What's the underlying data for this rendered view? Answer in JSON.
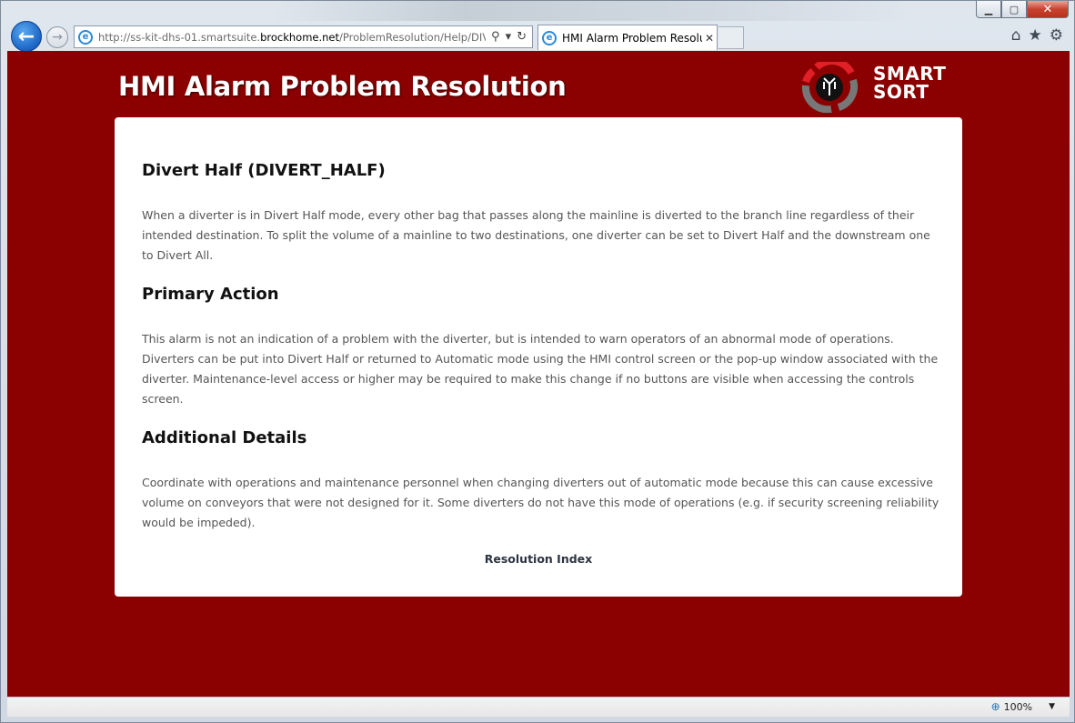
{
  "browser": {
    "url_prefix": "http://ss-kit-dhs-01.smartsuite.",
    "url_domain": "brockhome.net",
    "url_path": "/ProblemResolution/Help/DIVERT_",
    "tab_title": "HMI Alarm Problem Resolu...",
    "zoom_level": "100%"
  },
  "page": {
    "title": "HMI Alarm Problem Resolution",
    "logo_line1": "SMART",
    "logo_line2": "SORT",
    "sections": [
      {
        "heading": "Divert Half (DIVERT_HALF)",
        "text": "When a diverter is in Divert Half mode, every other bag that passes along the mainline is diverted to the branch line regardless of their intended destination. To split the volume of a mainline to two destinations, one diverter can be set to Divert Half and the downstream one to Divert All."
      },
      {
        "heading": "Primary Action",
        "text": "This alarm is not an indication of a problem with the diverter, but is intended to warn operators of an abnormal mode of operations. Diverters can be put into Divert Half or returned to Automatic mode using the HMI control screen or the pop-up window associated with the diverter. Maintenance-level access or higher may be required to make this change if no buttons are visible when accessing the controls screen."
      },
      {
        "heading": "Additional Details",
        "text": "Coordinate with operations and maintenance personnel when changing diverters out of automatic mode because this can cause excessive volume on conveyors that were not designed for it. Some diverters do not have this mode of operations (e.g. if security screening reliability would be impeded)."
      }
    ],
    "index_link": "Resolution Index"
  },
  "colors": {
    "page_background": "#8b0000",
    "logo_red": "#e01f26",
    "logo_grey": "#777777"
  },
  "icons": [
    "back-arrow-icon",
    "forward-arrow-icon",
    "ie-logo-icon",
    "search-icon",
    "dropdown-icon",
    "refresh-icon",
    "close-icon",
    "home-icon",
    "favorites-star-icon",
    "settings-gear-icon",
    "zoom-icon"
  ]
}
